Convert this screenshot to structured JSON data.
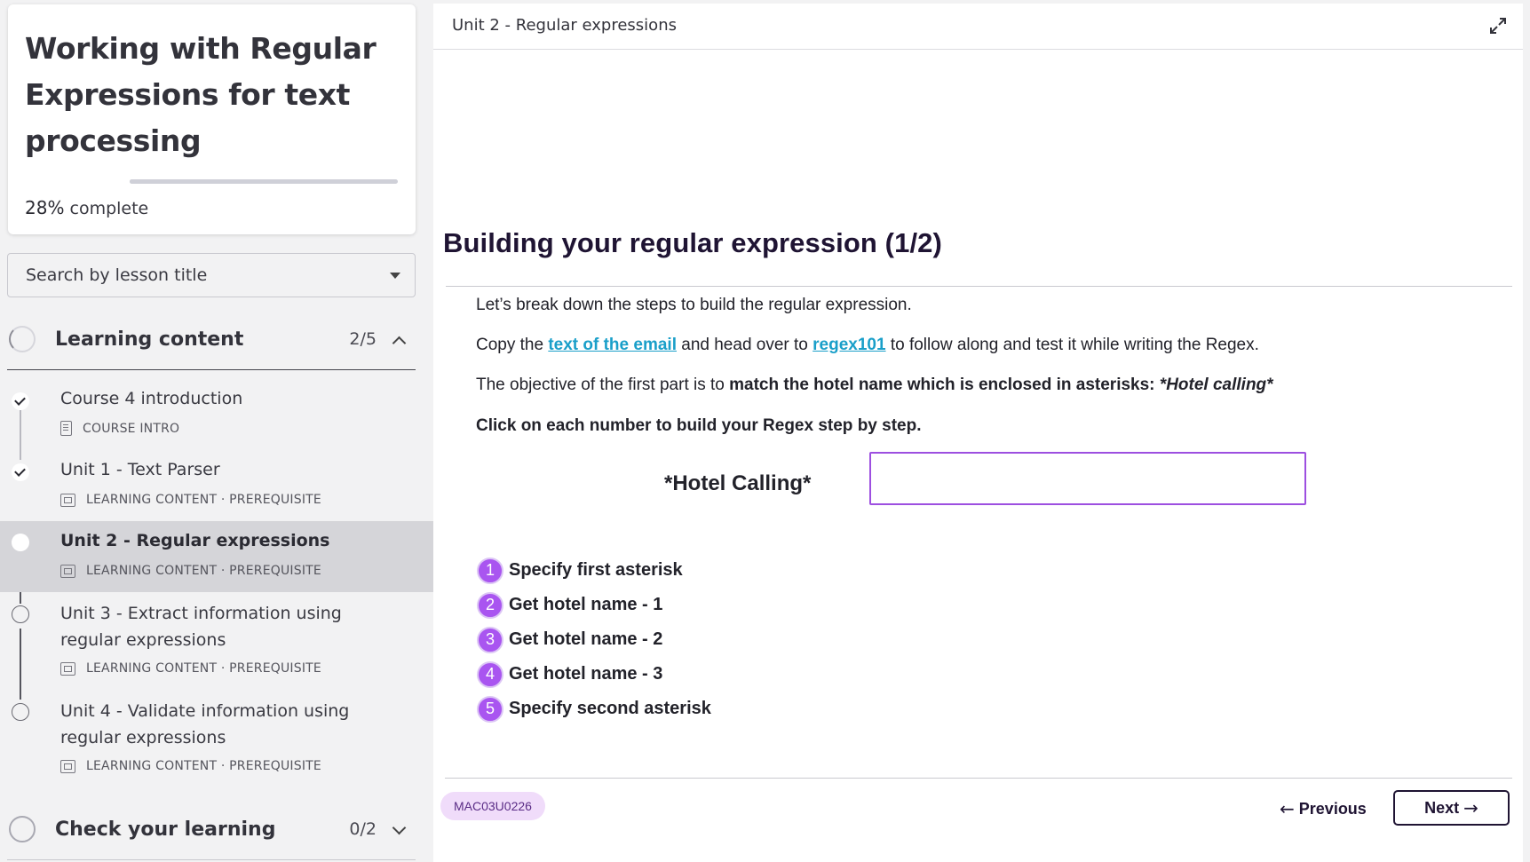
{
  "course": {
    "title": "Working with Regular Expressions for text processing",
    "progress_value": "28%",
    "progress_suffix": " complete",
    "progress_fraction": 0.28
  },
  "search": {
    "placeholder": "Search by lesson title"
  },
  "sections": [
    {
      "label": "Learning content",
      "count": "2/5",
      "expanded": true
    },
    {
      "label": "Check your learning",
      "count": "0/2",
      "expanded": false
    }
  ],
  "lessons": [
    {
      "title": "Course 4 introduction",
      "meta": "COURSE INTRO",
      "status": "complete",
      "icon": "document-icon"
    },
    {
      "title": "Unit 1 - Text Parser",
      "meta": "LEARNING CONTENT · PREREQUISITE",
      "status": "complete",
      "icon": "slides-icon"
    },
    {
      "title": "Unit 2 - Regular expressions",
      "meta": "LEARNING CONTENT · PREREQUISITE",
      "status": "current",
      "icon": "slides-icon"
    },
    {
      "title": "Unit 3 - Extract information using regular expressions",
      "meta": "LEARNING CONTENT · PREREQUISITE",
      "status": "not-started",
      "icon": "slides-icon"
    },
    {
      "title": "Unit 4 - Validate information using regular expressions",
      "meta": "LEARNING CONTENT · PREREQUISITE",
      "status": "not-started",
      "icon": "slides-icon"
    }
  ],
  "main": {
    "unit_title": "Unit 2 - Regular expressions",
    "heading": "Building your regular expression (1/2)",
    "p1": "Let’s break down the steps to build the regular expression.",
    "p2_pre": "Copy the ",
    "p2_link1": "text of the email",
    "p2_mid": " and head over to ",
    "p2_link2": "regex101",
    "p2_post": " to follow along and test it while writing the Regex.",
    "p3_pre": "The objective of the first part is to ",
    "p3_bold": "match the hotel name which is enclosed in asterisks: ",
    "p3_italic": "*Hotel calling*",
    "p4": "Click on each number to build your Regex step by step.",
    "hotel_label": "*Hotel Calling*",
    "answer_value": "",
    "steps": [
      {
        "num": "1",
        "text": "Specify first asterisk"
      },
      {
        "num": "2",
        "text": "Get hotel name - 1"
      },
      {
        "num": "3",
        "text": "Get hotel name - 2"
      },
      {
        "num": "4",
        "text": "Get hotel name - 3"
      },
      {
        "num": "5",
        "text": "Specify second asterisk"
      }
    ],
    "code": "MAC03U0226",
    "prev_label": "Previous",
    "next_label": "Next"
  },
  "colors": {
    "accent_purple": "#a955f0",
    "link_blue": "#1a9fc9",
    "heading_dark": "#1f1433",
    "pill_bg": "#f0dcfa"
  }
}
